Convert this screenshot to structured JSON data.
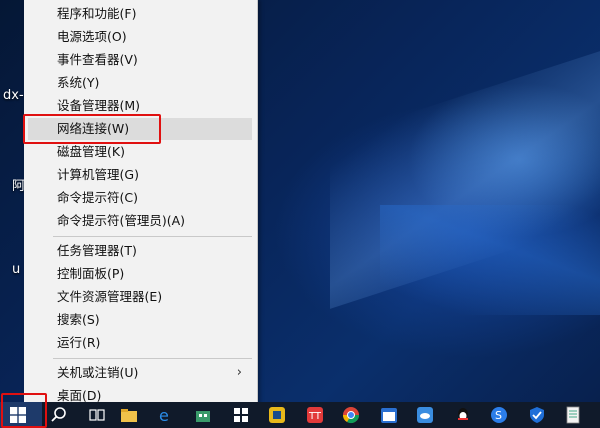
{
  "desktop": {
    "labels": [
      "dx-",
      "阿",
      "u"
    ]
  },
  "menu": {
    "group1": [
      "程序和功能(F)",
      "电源选项(O)",
      "事件查看器(V)",
      "系统(Y)",
      "设备管理器(M)",
      "网络连接(W)",
      "磁盘管理(K)",
      "计算机管理(G)",
      "命令提示符(C)",
      "命令提示符(管理员)(A)"
    ],
    "group2": [
      "任务管理器(T)",
      "控制面板(P)",
      "文件资源管理器(E)",
      "搜索(S)",
      "运行(R)"
    ],
    "group3": [
      "关机或注销(U)",
      "桌面(D)"
    ],
    "submenu_arrow": "›",
    "highlighted_item": "网络连接(W)"
  },
  "taskbar": {
    "icons": [
      "search-icon",
      "task-view-icon",
      "file-explorer-icon",
      "edge-icon",
      "store-icon",
      "windows-icon",
      "screenshot-icon",
      "music-icon",
      "chrome-icon",
      "calendar-icon",
      "cloud-icon",
      "qq-icon",
      "sogou-icon",
      "security-icon",
      "notes-icon"
    ],
    "accent": "#1e3a6a"
  },
  "annotation_color": "#e01010"
}
